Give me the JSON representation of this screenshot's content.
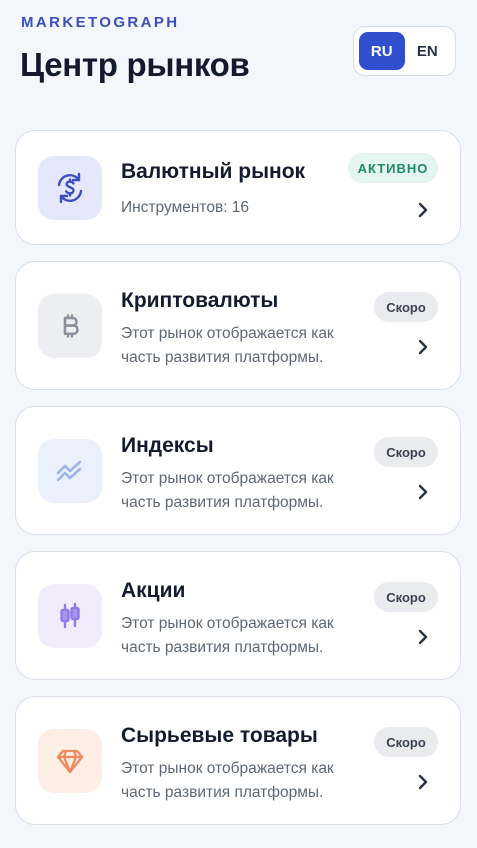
{
  "header": {
    "brand": "MARKETOGRAPH",
    "title": "Центр рынков"
  },
  "language": {
    "options": [
      "RU",
      "EN"
    ],
    "selected": "RU"
  },
  "colors": {
    "accent": "#2f4fce",
    "active_badge_bg": "#e5f5ef",
    "active_badge_text": "#1f8a63"
  },
  "markets": [
    {
      "title": "Валютный рынок",
      "subtitle": "Инструментов: 16",
      "badge": "АКТИВНО",
      "status": "active",
      "icon": "currency-exchange-icon"
    },
    {
      "title": "Криптовалюты",
      "subtitle": "Этот рынок отображается как часть развития платформы.",
      "badge": "Скоро",
      "status": "soon",
      "icon": "bitcoin-icon"
    },
    {
      "title": "Индексы",
      "subtitle": "Этот рынок отображается как часть развития платформы.",
      "badge": "Скоро",
      "status": "soon",
      "icon": "trend-chart-icon"
    },
    {
      "title": "Акции",
      "subtitle": "Этот рынок отображается как часть развития платформы.",
      "badge": "Скоро",
      "status": "soon",
      "icon": "candlestick-icon"
    },
    {
      "title": "Сырьевые товары",
      "subtitle": "Этот рынок отображается как часть развития платформы.",
      "badge": "Скоро",
      "status": "soon",
      "icon": "diamond-icon"
    }
  ]
}
